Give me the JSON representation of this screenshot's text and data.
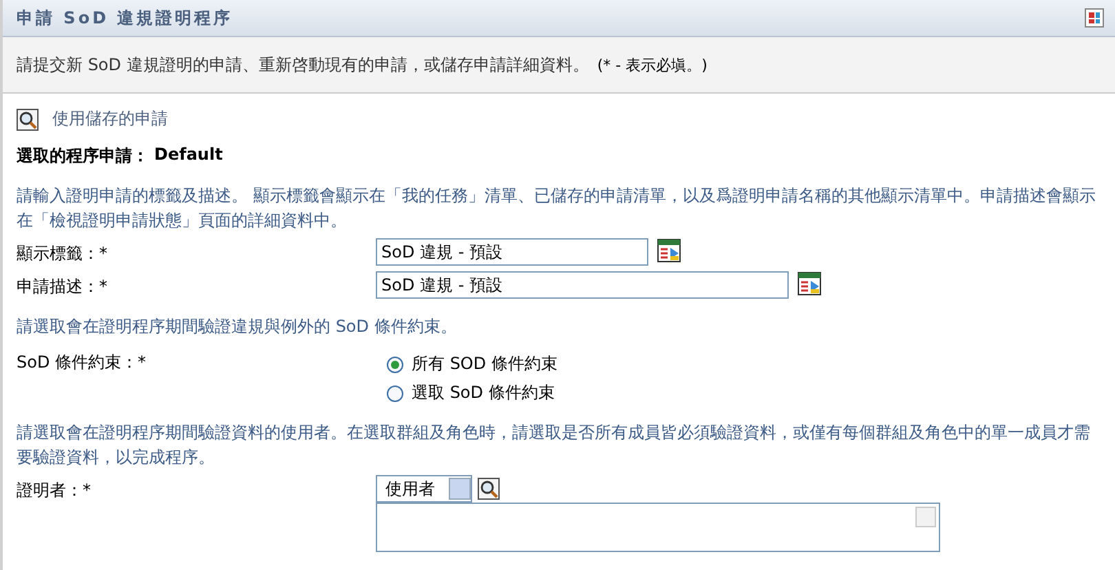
{
  "header": {
    "title": "申請 SoD 違規證明程序"
  },
  "intro": {
    "text": "請提交新 SoD 違規證明的申請、重新啓動現有的申請，或儲存申請詳細資料。",
    "note": "(* - 表示必塡。)"
  },
  "saved_link": "使用儲存的申請",
  "selected_request": {
    "label": "選取的程序申請：",
    "value": "Default"
  },
  "sections": [
    {
      "instruction": "請輸入證明申請的標籤及描述。 顯示標籤會顯示在「我的任務」清單、已儲存的申請清單，以及爲證明申請名稱的其他顯示清單中。申請描述會顯示在「檢視證明申請狀態」頁面的詳細資料中。",
      "fields": [
        {
          "kind": "text",
          "label": "顯示標籤：*",
          "value": "SoD 違規 - 預設"
        },
        {
          "kind": "text",
          "label": "申請描述：*",
          "value": "SoD 違規 - 預設"
        }
      ]
    },
    {
      "instruction": "請選取會在證明程序期間驗證違規與例外的 SoD 條件約束。",
      "fields": [
        {
          "kind": "radio",
          "label": "SoD 條件約束：*",
          "options": [
            {
              "label": "所有 SOD 條件約束",
              "selected": true
            },
            {
              "label": "選取 SoD 條件約束",
              "selected": false
            }
          ]
        }
      ]
    },
    {
      "instruction": "請選取會在證明程序期間驗證資料的使用者。在選取群組及角色時，請選取是否所有成員皆必須驗證資料，或僅有每個群組及角色中的單一成員才需要驗證資料，以完成程序。",
      "fields": [
        {
          "kind": "picker",
          "label": "證明者：*",
          "value": "使用者"
        }
      ]
    }
  ]
}
